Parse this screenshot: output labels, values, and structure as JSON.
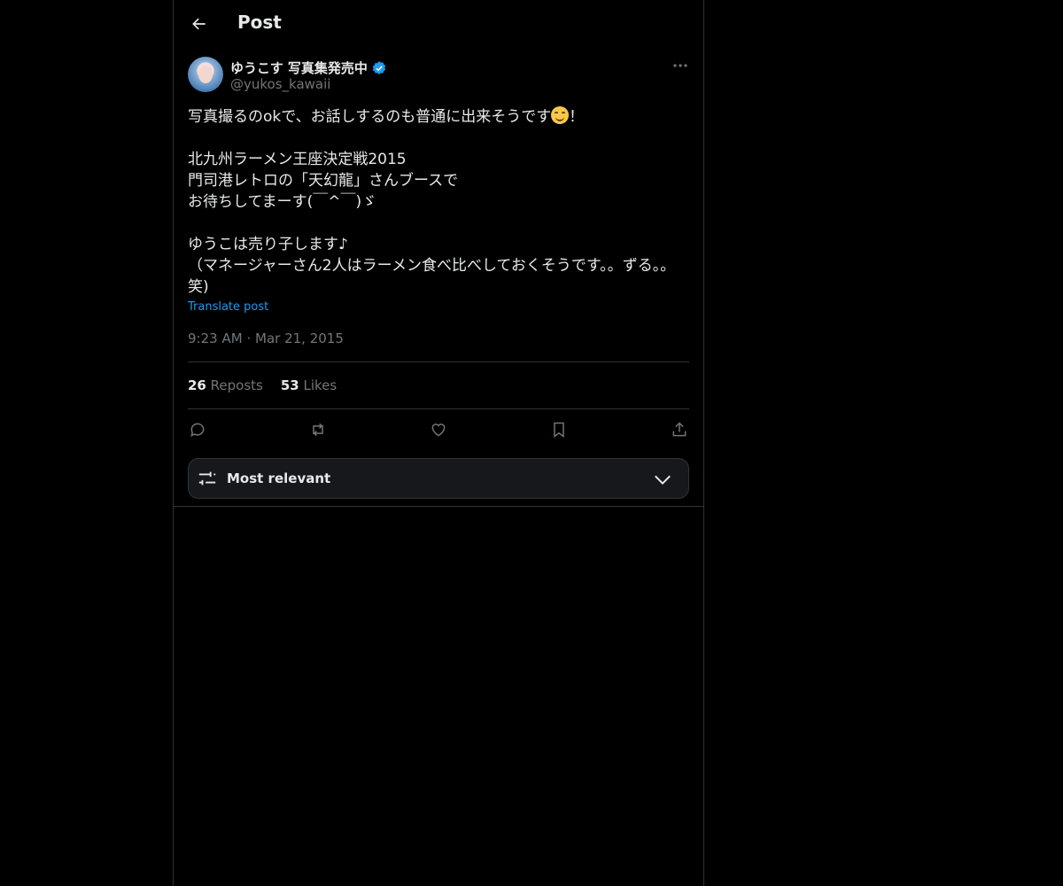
{
  "header": {
    "title": "Post"
  },
  "author": {
    "display_name": "ゆうこす 写真集発売中",
    "handle": "@yukos_kawaii"
  },
  "tweet": {
    "line1a": "写真撮るのokで、お話しするのも普通に出来そうです",
    "line1b": "！",
    "body": "北九州ラーメン王座決定戦2015\n門司港レトロの「天幻龍」さんブースで\nお待ちしてまーす(￣^￣)ゞ\n\nゆうこは売り子します♪\n（マネージャーさん2人はラーメン食べ比べしておくそうです。。ずる。。笑)"
  },
  "translate_label": "Translate post",
  "meta": {
    "time": "9:23 AM",
    "separator": "·",
    "date": "Mar 21, 2015"
  },
  "stats": {
    "reposts_count": "26",
    "reposts_label": "Reposts",
    "likes_count": "53",
    "likes_label": "Likes"
  },
  "sort": {
    "label": "Most relevant"
  },
  "icons": {
    "back": "arrow-left-icon",
    "verified": "verified-badge-icon",
    "more": "more-icon",
    "reply": "reply-icon",
    "repost": "repost-icon",
    "like": "heart-icon",
    "bookmark": "bookmark-icon",
    "share": "share-icon",
    "sort": "sliders-icon",
    "chevron": "chevron-down-icon"
  },
  "colors": {
    "background": "#000000",
    "text": "#e7e9ea",
    "muted": "#71767b",
    "accent": "#1d9bf0",
    "border": "#2f3336"
  }
}
